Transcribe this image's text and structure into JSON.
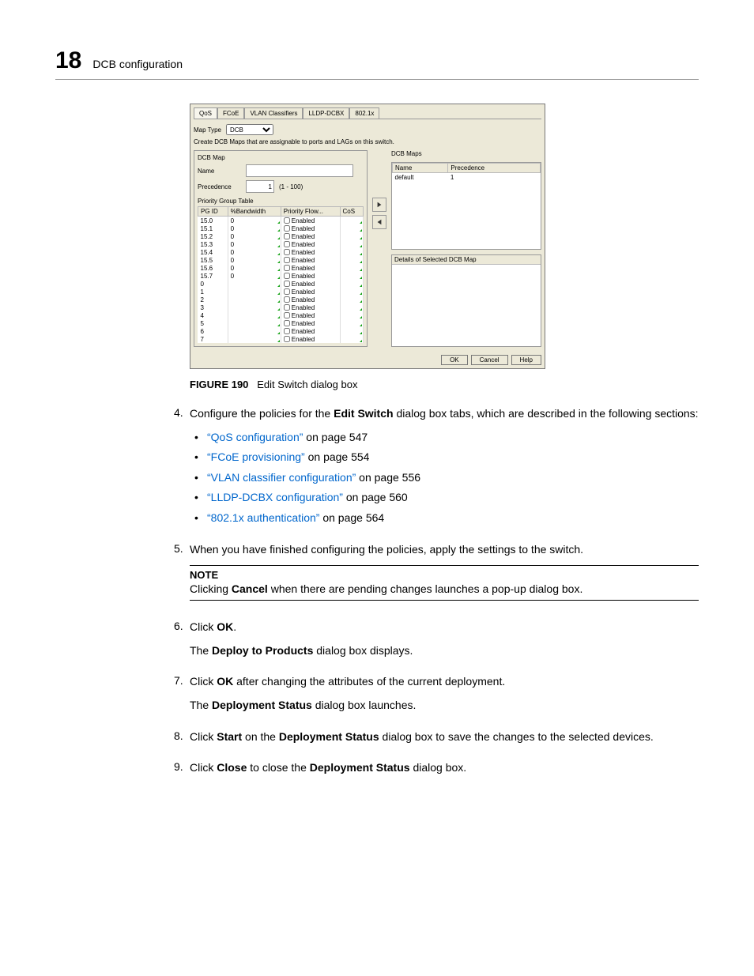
{
  "header": {
    "page_number": "18",
    "title": "DCB configuration"
  },
  "dialog": {
    "tabs": [
      "QoS",
      "FCoE",
      "VLAN Classifiers",
      "LLDP-DCBX",
      "802.1x"
    ],
    "active_tab_index": 0,
    "map_type_label": "Map Type",
    "map_type_value": "DCB",
    "instr_text": "Create DCB Maps that are assignable to ports and LAGs on this switch.",
    "left": {
      "section_label": "DCB Map",
      "name_label": "Name",
      "name_value": "",
      "precedence_label": "Precedence",
      "precedence_value": "1",
      "precedence_range": "(1 - 100)",
      "pg_table_label": "Priority Group Table",
      "pg_cols": [
        "PG ID",
        "%Bandwidth",
        "Priority Flow...",
        "CoS"
      ],
      "pg_rows": [
        {
          "id": "15.0",
          "bw": "0",
          "pf": "Enabled"
        },
        {
          "id": "15.1",
          "bw": "0",
          "pf": "Enabled"
        },
        {
          "id": "15.2",
          "bw": "0",
          "pf": "Enabled"
        },
        {
          "id": "15.3",
          "bw": "0",
          "pf": "Enabled"
        },
        {
          "id": "15.4",
          "bw": "0",
          "pf": "Enabled"
        },
        {
          "id": "15.5",
          "bw": "0",
          "pf": "Enabled"
        },
        {
          "id": "15.6",
          "bw": "0",
          "pf": "Enabled"
        },
        {
          "id": "15.7",
          "bw": "0",
          "pf": "Enabled"
        },
        {
          "id": "0",
          "bw": "",
          "pf": "Enabled"
        },
        {
          "id": "1",
          "bw": "",
          "pf": "Enabled"
        },
        {
          "id": "2",
          "bw": "",
          "pf": "Enabled"
        },
        {
          "id": "3",
          "bw": "",
          "pf": "Enabled"
        },
        {
          "id": "4",
          "bw": "",
          "pf": "Enabled"
        },
        {
          "id": "5",
          "bw": "",
          "pf": "Enabled"
        },
        {
          "id": "6",
          "bw": "",
          "pf": "Enabled"
        },
        {
          "id": "7",
          "bw": "",
          "pf": "Enabled"
        }
      ]
    },
    "right": {
      "maps_label": "DCB Maps",
      "maps_cols": [
        "Name",
        "Precedence"
      ],
      "maps_rows": [
        {
          "name": "default",
          "precedence": "1"
        }
      ],
      "details_label": "Details of Selected DCB Map"
    },
    "buttons": {
      "ok": "OK",
      "cancel": "Cancel",
      "help": "Help"
    }
  },
  "figure": {
    "label": "FIGURE 190",
    "caption": "Edit Switch dialog box"
  },
  "steps": {
    "s4": {
      "num": "4.",
      "intro_a": "Configure the policies for the ",
      "intro_bold": "Edit Switch",
      "intro_b": " dialog box tabs, which are described in the following sections:",
      "links": [
        {
          "text": "“QoS configuration”",
          "suffix": " on page 547"
        },
        {
          "text": "“FCoE provisioning”",
          "suffix": " on page 554"
        },
        {
          "text": "“VLAN classifier configuration”",
          "suffix": " on page 556"
        },
        {
          "text": "“LLDP-DCBX configuration”",
          "suffix": " on page 560"
        },
        {
          "text": "“802.1x authentication”",
          "suffix": " on page 564"
        }
      ]
    },
    "s5": {
      "num": "5.",
      "text": "When you have finished configuring the policies, apply the settings to the switch.",
      "note_label": "NOTE",
      "note_a": "Clicking ",
      "note_bold": "Cancel",
      "note_b": " when there are pending changes launches a pop-up dialog box."
    },
    "s6": {
      "num": "6.",
      "l1_a": "Click ",
      "l1_bold": "OK",
      "l1_b": ".",
      "l2_a": "The ",
      "l2_bold": "Deploy to Products",
      "l2_b": " dialog box displays."
    },
    "s7": {
      "num": "7.",
      "l1_a": "Click ",
      "l1_bold": "OK",
      "l1_b": " after changing the attributes of the current deployment.",
      "l2_a": "The ",
      "l2_bold": "Deployment Status",
      "l2_b": " dialog box launches."
    },
    "s8": {
      "num": "8.",
      "a": "Click ",
      "b1": "Start",
      "c": " on the ",
      "b2": "Deployment Status",
      "d": " dialog box to save the changes to the selected devices."
    },
    "s9": {
      "num": "9.",
      "a": "Click ",
      "b1": "Close",
      "c": " to close the ",
      "b2": "Deployment Status",
      "d": " dialog box."
    }
  }
}
